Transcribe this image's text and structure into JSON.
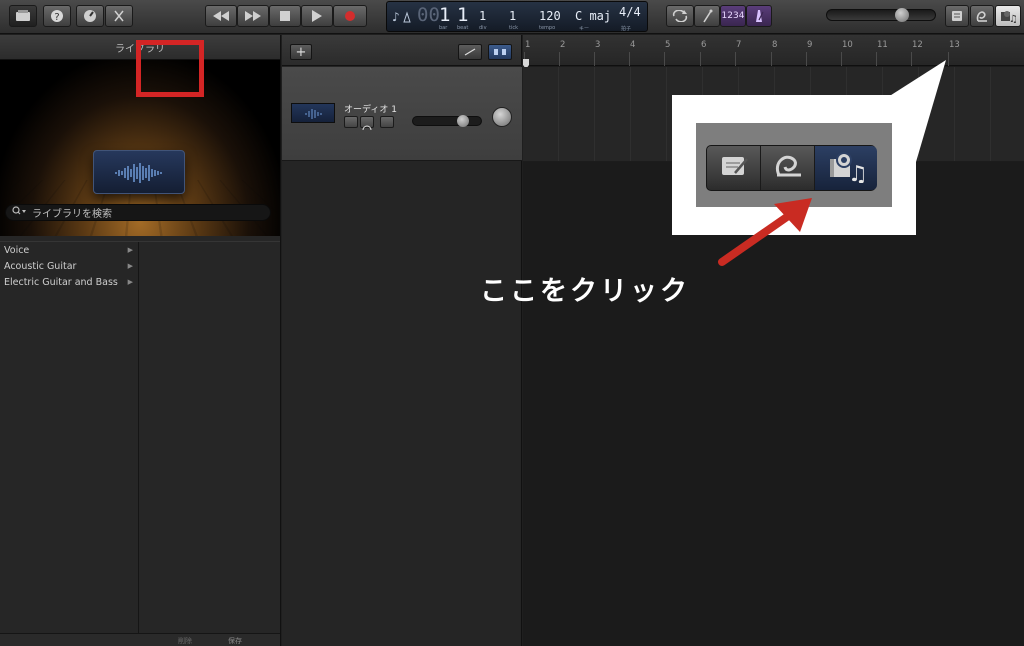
{
  "toolbar": {
    "buttons": [
      {
        "id": "library",
        "icon": "library-icon",
        "active": true
      },
      {
        "id": "help",
        "icon": "help-icon"
      },
      {
        "id": "smart-controls",
        "icon": "smart-controls-icon"
      },
      {
        "id": "editors",
        "icon": "scissors-icon"
      },
      {
        "id": "rewind",
        "icon": "rewind-icon"
      },
      {
        "id": "fast-forward",
        "icon": "fast-forward-icon"
      },
      {
        "id": "stop",
        "icon": "stop-icon"
      },
      {
        "id": "play",
        "icon": "play-icon"
      },
      {
        "id": "record",
        "icon": "record-icon"
      },
      {
        "id": "cycle",
        "icon": "cycle-icon"
      },
      {
        "id": "tuner",
        "icon": "tuner-icon"
      },
      {
        "id": "count-in",
        "icon": "count-in-icon",
        "label": "1234"
      },
      {
        "id": "metronome",
        "icon": "metronome-icon"
      },
      {
        "id": "notepad",
        "icon": "notepad-icon"
      },
      {
        "id": "apple-loops",
        "icon": "loop-icon"
      },
      {
        "id": "media-browser",
        "icon": "media-browser-icon"
      }
    ],
    "lcd": {
      "bar": "1",
      "beat": "1",
      "div": "1",
      "tick": "1",
      "tempo": "120",
      "key": "C maj",
      "signature": "4/4",
      "sub_bar": "bar",
      "sub_beat": "beat",
      "sub_div": "div",
      "sub_tick": "tick",
      "sub_tempo": "tempo",
      "sub_key": "キー",
      "sub_sig": "拍子"
    }
  },
  "library": {
    "title": "ライブラリ",
    "search_placeholder": "ライブラリを検索",
    "categories": [
      {
        "label": "Voice"
      },
      {
        "label": "Acoustic Guitar"
      },
      {
        "label": "Electric Guitar and Bass"
      }
    ],
    "footer_left": "削除",
    "footer_right": "保存"
  },
  "tracks": {
    "add_label": "+",
    "track": {
      "name": "オーディオ 1"
    }
  },
  "ruler": {
    "labels": [
      "1",
      "2",
      "3",
      "4",
      "5",
      "6",
      "7",
      "8",
      "9",
      "10",
      "11",
      "12",
      "13"
    ]
  },
  "annotation": {
    "click_here": "ここをクリック",
    "highlight_color": "#d42525",
    "arrow_color": "#c92b22"
  }
}
